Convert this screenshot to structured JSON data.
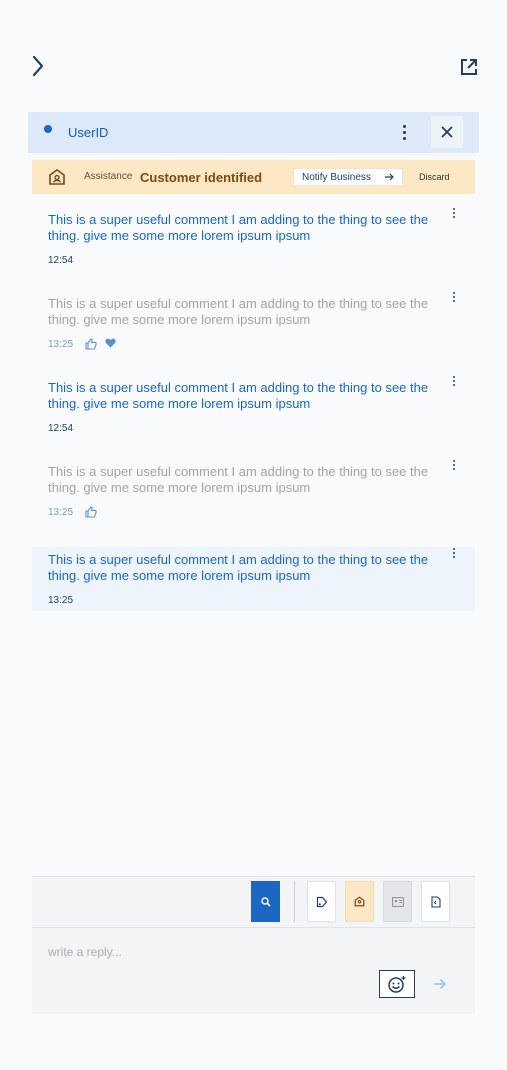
{
  "header": {
    "user_id": "UserID"
  },
  "banner": {
    "label": "Assistance",
    "title": "Customer identified",
    "notify_label": "Notify Business",
    "discard_label": "Discard"
  },
  "messages": [
    {
      "sender": "own",
      "text": "This is a super useful comment I am adding to the thing to see the thing. give me some more lorem ipsum ipsum",
      "time": "12:54",
      "reactions": []
    },
    {
      "sender": "other",
      "text": "This is a super useful comment I am adding to the thing to see the thing. give me some more lorem ipsum ipsum",
      "time": "13:25",
      "reactions": [
        "thumbs-up-icon",
        "heart-icon"
      ]
    },
    {
      "sender": "own",
      "text": "This is a super useful comment I am adding to the thing to see the thing. give me some more lorem ipsum ipsum",
      "time": "12:54",
      "reactions": []
    },
    {
      "sender": "other",
      "text": "This is a super useful comment I am adding to the thing to see the thing. give me some more lorem ipsum ipsum",
      "time": "13:25",
      "reactions": [
        "thumbs-up-icon"
      ]
    },
    {
      "sender": "own",
      "text": "This is a super useful comment I am adding to the thing to see the thing. give me some more lorem ipsum ipsum",
      "time": "13:25",
      "reactions": [],
      "highlighted": true
    }
  ],
  "composer": {
    "placeholder": "write a reply...",
    "tools": [
      "search-icon",
      "tag-icon",
      "store-icon",
      "id-card-icon",
      "document-icon"
    ]
  },
  "colors": {
    "accent": "#1c66c4",
    "header_bg": "#dbe9f8",
    "banner_bg": "#fde8c6",
    "other_text": "#a3a3a3"
  }
}
